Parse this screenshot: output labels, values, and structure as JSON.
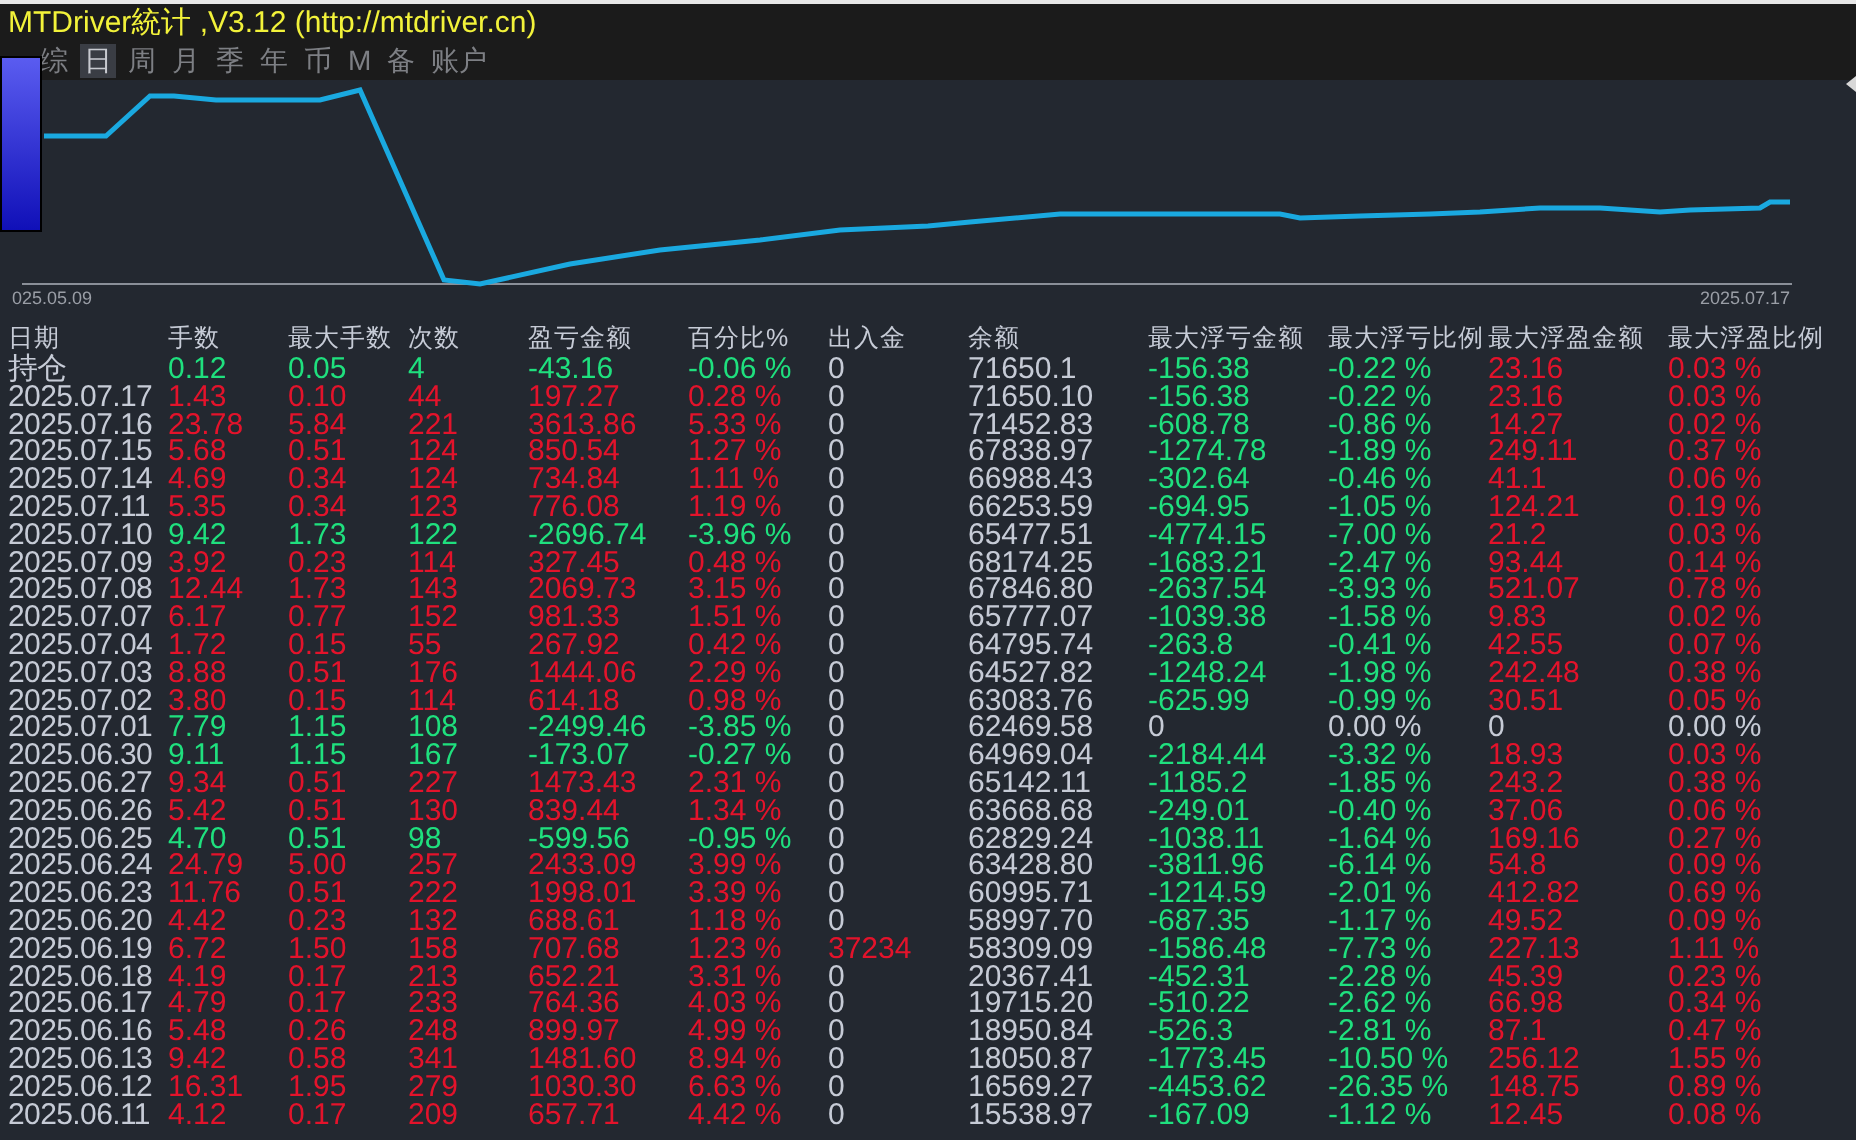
{
  "window": {
    "title": "MTDriver統计 ,V3.12 (http://mtdriver.cn)"
  },
  "tabs": [
    {
      "label": "综",
      "selected": false
    },
    {
      "label": "日",
      "selected": true
    },
    {
      "label": "周",
      "selected": false
    },
    {
      "label": "月",
      "selected": false
    },
    {
      "label": "季",
      "selected": false
    },
    {
      "label": "年",
      "selected": false
    },
    {
      "label": "币",
      "selected": false
    },
    {
      "label": "M",
      "selected": false
    },
    {
      "label": "备",
      "selected": false
    },
    {
      "label": "账户",
      "selected": false
    }
  ],
  "chart": {
    "start_label": "025.05.09",
    "end_label": "2025.07.17"
  },
  "table": {
    "columns": [
      "日期",
      "手数",
      "最大手数",
      "次数",
      "盈亏金额",
      "百分比%",
      "出入金",
      "余额",
      "最大浮亏金额",
      "最大浮亏比例",
      "最大浮盈金额",
      "最大浮盈比例"
    ],
    "rows": [
      {
        "loss": true,
        "float_flat": false,
        "deposit": false,
        "cells": [
          "持仓",
          "0.12",
          "0.05",
          "4",
          "-43.16",
          "-0.06 %",
          "0",
          "71650.1",
          "-156.38",
          "-0.22 %",
          "23.16",
          "0.03 %"
        ]
      },
      {
        "loss": false,
        "float_flat": false,
        "deposit": false,
        "cells": [
          "2025.07.17",
          "1.43",
          "0.10",
          "44",
          "197.27",
          "0.28 %",
          "0",
          "71650.10",
          "-156.38",
          "-0.22 %",
          "23.16",
          "0.03 %"
        ]
      },
      {
        "loss": false,
        "float_flat": false,
        "deposit": false,
        "cells": [
          "2025.07.16",
          "23.78",
          "5.84",
          "221",
          "3613.86",
          "5.33 %",
          "0",
          "71452.83",
          "-608.78",
          "-0.86 %",
          "14.27",
          "0.02 %"
        ]
      },
      {
        "loss": false,
        "float_flat": false,
        "deposit": false,
        "cells": [
          "2025.07.15",
          "5.68",
          "0.51",
          "124",
          "850.54",
          "1.27 %",
          "0",
          "67838.97",
          "-1274.78",
          "-1.89 %",
          "249.11",
          "0.37 %"
        ]
      },
      {
        "loss": false,
        "float_flat": false,
        "deposit": false,
        "cells": [
          "2025.07.14",
          "4.69",
          "0.34",
          "124",
          "734.84",
          "1.11 %",
          "0",
          "66988.43",
          "-302.64",
          "-0.46 %",
          "41.1",
          "0.06 %"
        ]
      },
      {
        "loss": false,
        "float_flat": false,
        "deposit": false,
        "cells": [
          "2025.07.11",
          "5.35",
          "0.34",
          "123",
          "776.08",
          "1.19 %",
          "0",
          "66253.59",
          "-694.95",
          "-1.05 %",
          "124.21",
          "0.19 %"
        ]
      },
      {
        "loss": true,
        "float_flat": false,
        "deposit": false,
        "cells": [
          "2025.07.10",
          "9.42",
          "1.73",
          "122",
          "-2696.74",
          "-3.96 %",
          "0",
          "65477.51",
          "-4774.15",
          "-7.00 %",
          "21.2",
          "0.03 %"
        ]
      },
      {
        "loss": false,
        "float_flat": false,
        "deposit": false,
        "cells": [
          "2025.07.09",
          "3.92",
          "0.23",
          "114",
          "327.45",
          "0.48 %",
          "0",
          "68174.25",
          "-1683.21",
          "-2.47 %",
          "93.44",
          "0.14 %"
        ]
      },
      {
        "loss": false,
        "float_flat": false,
        "deposit": false,
        "cells": [
          "2025.07.08",
          "12.44",
          "1.73",
          "143",
          "2069.73",
          "3.15 %",
          "0",
          "67846.80",
          "-2637.54",
          "-3.93 %",
          "521.07",
          "0.78 %"
        ]
      },
      {
        "loss": false,
        "float_flat": false,
        "deposit": false,
        "cells": [
          "2025.07.07",
          "6.17",
          "0.77",
          "152",
          "981.33",
          "1.51 %",
          "0",
          "65777.07",
          "-1039.38",
          "-1.58 %",
          "9.83",
          "0.02 %"
        ]
      },
      {
        "loss": false,
        "float_flat": false,
        "deposit": false,
        "cells": [
          "2025.07.04",
          "1.72",
          "0.15",
          "55",
          "267.92",
          "0.42 %",
          "0",
          "64795.74",
          "-263.8",
          "-0.41 %",
          "42.55",
          "0.07 %"
        ]
      },
      {
        "loss": false,
        "float_flat": false,
        "deposit": false,
        "cells": [
          "2025.07.03",
          "8.88",
          "0.51",
          "176",
          "1444.06",
          "2.29 %",
          "0",
          "64527.82",
          "-1248.24",
          "-1.98 %",
          "242.48",
          "0.38 %"
        ]
      },
      {
        "loss": false,
        "float_flat": false,
        "deposit": false,
        "cells": [
          "2025.07.02",
          "3.80",
          "0.15",
          "114",
          "614.18",
          "0.98 %",
          "0",
          "63083.76",
          "-625.99",
          "-0.99 %",
          "30.51",
          "0.05 %"
        ]
      },
      {
        "loss": true,
        "float_flat": true,
        "deposit": false,
        "cells": [
          "2025.07.01",
          "7.79",
          "1.15",
          "108",
          "-2499.46",
          "-3.85 %",
          "0",
          "62469.58",
          "0",
          "0.00 %",
          "0",
          "0.00 %"
        ]
      },
      {
        "loss": true,
        "float_flat": false,
        "deposit": false,
        "cells": [
          "2025.06.30",
          "9.11",
          "1.15",
          "167",
          "-173.07",
          "-0.27 %",
          "0",
          "64969.04",
          "-2184.44",
          "-3.32 %",
          "18.93",
          "0.03 %"
        ]
      },
      {
        "loss": false,
        "float_flat": false,
        "deposit": false,
        "cells": [
          "2025.06.27",
          "9.34",
          "0.51",
          "227",
          "1473.43",
          "2.31 %",
          "0",
          "65142.11",
          "-1185.2",
          "-1.85 %",
          "243.2",
          "0.38 %"
        ]
      },
      {
        "loss": false,
        "float_flat": false,
        "deposit": false,
        "cells": [
          "2025.06.26",
          "5.42",
          "0.51",
          "130",
          "839.44",
          "1.34 %",
          "0",
          "63668.68",
          "-249.01",
          "-0.40 %",
          "37.06",
          "0.06 %"
        ]
      },
      {
        "loss": true,
        "float_flat": false,
        "deposit": false,
        "cells": [
          "2025.06.25",
          "4.70",
          "0.51",
          "98",
          "-599.56",
          "-0.95 %",
          "0",
          "62829.24",
          "-1038.11",
          "-1.64 %",
          "169.16",
          "0.27 %"
        ]
      },
      {
        "loss": false,
        "float_flat": false,
        "deposit": false,
        "cells": [
          "2025.06.24",
          "24.79",
          "5.00",
          "257",
          "2433.09",
          "3.99 %",
          "0",
          "63428.80",
          "-3811.96",
          "-6.14 %",
          "54.8",
          "0.09 %"
        ]
      },
      {
        "loss": false,
        "float_flat": false,
        "deposit": false,
        "cells": [
          "2025.06.23",
          "11.76",
          "0.51",
          "222",
          "1998.01",
          "3.39 %",
          "0",
          "60995.71",
          "-1214.59",
          "-2.01 %",
          "412.82",
          "0.69 %"
        ]
      },
      {
        "loss": false,
        "float_flat": false,
        "deposit": false,
        "cells": [
          "2025.06.20",
          "4.42",
          "0.23",
          "132",
          "688.61",
          "1.18 %",
          "0",
          "58997.70",
          "-687.35",
          "-1.17 %",
          "49.52",
          "0.09 %"
        ]
      },
      {
        "loss": false,
        "float_flat": false,
        "deposit": true,
        "cells": [
          "2025.06.19",
          "6.72",
          "1.50",
          "158",
          "707.68",
          "1.23 %",
          "37234",
          "58309.09",
          "-1586.48",
          "-7.73 %",
          "227.13",
          "1.11 %"
        ]
      },
      {
        "loss": false,
        "float_flat": false,
        "deposit": false,
        "cells": [
          "2025.06.18",
          "4.19",
          "0.17",
          "213",
          "652.21",
          "3.31 %",
          "0",
          "20367.41",
          "-452.31",
          "-2.28 %",
          "45.39",
          "0.23 %"
        ]
      },
      {
        "loss": false,
        "float_flat": false,
        "deposit": false,
        "cells": [
          "2025.06.17",
          "4.79",
          "0.17",
          "233",
          "764.36",
          "4.03 %",
          "0",
          "19715.20",
          "-510.22",
          "-2.62 %",
          "66.98",
          "0.34 %"
        ]
      },
      {
        "loss": false,
        "float_flat": false,
        "deposit": false,
        "cells": [
          "2025.06.16",
          "5.48",
          "0.26",
          "248",
          "899.97",
          "4.99 %",
          "0",
          "18950.84",
          "-526.3",
          "-2.81 %",
          "87.1",
          "0.47 %"
        ]
      },
      {
        "loss": false,
        "float_flat": false,
        "deposit": false,
        "cells": [
          "2025.06.13",
          "9.42",
          "0.58",
          "341",
          "1481.60",
          "8.94 %",
          "0",
          "18050.87",
          "-1773.45",
          "-10.50 %",
          "256.12",
          "1.55 %"
        ]
      },
      {
        "loss": false,
        "float_flat": false,
        "deposit": false,
        "cells": [
          "2025.06.12",
          "16.31",
          "1.95",
          "279",
          "1030.30",
          "6.63 %",
          "0",
          "16569.27",
          "-4453.62",
          "-26.35 %",
          "148.75",
          "0.89 %"
        ]
      },
      {
        "loss": false,
        "float_flat": false,
        "deposit": false,
        "cells": [
          "2025.06.11",
          "4.12",
          "0.17",
          "209",
          "657.71",
          "4.42 %",
          "0",
          "15538.97",
          "-167.09",
          "-1.12 %",
          "12.45",
          "0.08 %"
        ]
      }
    ]
  }
}
